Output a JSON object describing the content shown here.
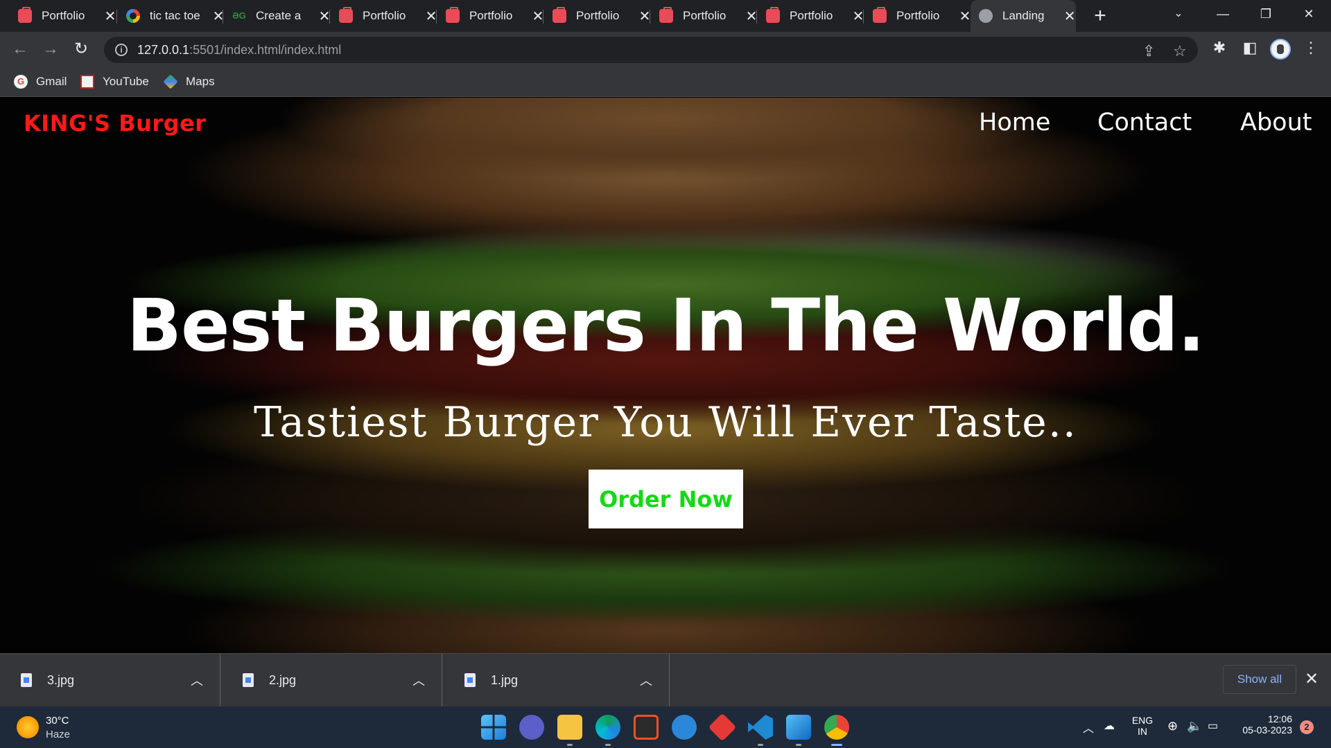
{
  "browser": {
    "tabs": [
      {
        "label": "Portfolio",
        "favicon": "briefcase-icon",
        "active": false
      },
      {
        "label": "tic tac toe",
        "favicon": "google-icon",
        "active": false
      },
      {
        "label": "Create a",
        "favicon": "gfg-icon",
        "active": false
      },
      {
        "label": "Portfolio",
        "favicon": "briefcase-icon",
        "active": false
      },
      {
        "label": "Portfolio",
        "favicon": "briefcase-icon",
        "active": false
      },
      {
        "label": "Portfolio",
        "favicon": "briefcase-icon",
        "active": false
      },
      {
        "label": "Portfolio",
        "favicon": "briefcase-icon",
        "active": false
      },
      {
        "label": "Portfolio",
        "favicon": "briefcase-icon",
        "active": false
      },
      {
        "label": "Portfolio",
        "favicon": "briefcase-icon",
        "active": false
      },
      {
        "label": "Landing",
        "favicon": "globe-icon",
        "active": true
      }
    ],
    "url": {
      "host": "127.0.0.1",
      "rest": ":5501/index.html/index.html"
    },
    "bookmarks": [
      {
        "label": "Gmail",
        "icon": "gmail-icon"
      },
      {
        "label": "YouTube",
        "icon": "youtube-icon"
      },
      {
        "label": "Maps",
        "icon": "maps-icon"
      }
    ]
  },
  "page": {
    "brand": "KING'S Burger",
    "nav": [
      "Home",
      "Contact",
      "About"
    ],
    "hero_title": "Best Burgers In The World.",
    "hero_subtitle": "Tastiest Burger You Will Ever Taste..",
    "cta_label": "Order Now",
    "colors": {
      "brand": "#ff1a1a",
      "cta_text": "#17d817",
      "cta_bg": "#ffffff"
    }
  },
  "downloads": {
    "items": [
      {
        "name": "3.jpg"
      },
      {
        "name": "2.jpg"
      },
      {
        "name": "1.jpg"
      }
    ],
    "show_all": "Show all"
  },
  "taskbar": {
    "weather": {
      "temp": "30°C",
      "condition": "Haze"
    },
    "language": {
      "line1": "ENG",
      "line2": "IN"
    },
    "clock": {
      "time": "12:06",
      "date": "05-03-2023"
    },
    "notifications": "2"
  }
}
